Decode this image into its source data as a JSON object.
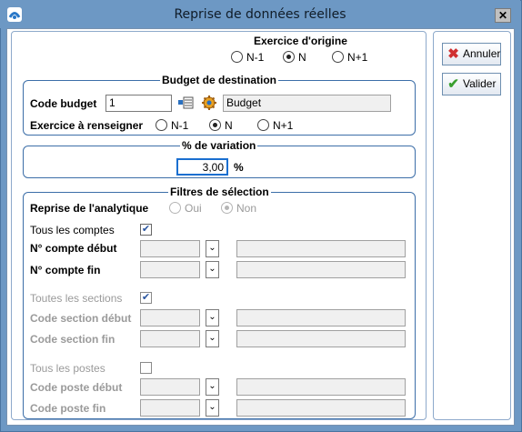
{
  "window": {
    "title": "Reprise de données réelles"
  },
  "origin": {
    "title": "Exercice d'origine",
    "options": [
      "N-1",
      "N",
      "N+1"
    ],
    "selected": "N"
  },
  "budget": {
    "group_title": "Budget de destination",
    "code_label": "Code budget",
    "code_value": "1",
    "name_value": "Budget",
    "exercise_label": "Exercice à renseigner",
    "options": [
      "N-1",
      "N",
      "N+1"
    ],
    "selected": "N"
  },
  "variation": {
    "group_title": "% de variation",
    "value": "3,00",
    "unit": "%"
  },
  "filters": {
    "group_title": "Filtres de sélection",
    "analytic_label": "Reprise de l'analytique",
    "analytic_options": [
      "Oui",
      "Non"
    ],
    "analytic_selected": "Non",
    "all_accounts_label": "Tous les comptes",
    "all_accounts_checked": true,
    "account_start_label": "N° compte début",
    "account_end_label": "N° compte fin",
    "all_sections_label": "Toutes les sections",
    "all_sections_checked": true,
    "section_start_label": "Code section début",
    "section_end_label": "Code section fin",
    "all_posts_label": "Tous les postes",
    "all_posts_checked": false,
    "post_start_label": "Code poste début",
    "post_end_label": "Code poste fin"
  },
  "buttons": {
    "cancel": "Annuler",
    "validate": "Valider"
  }
}
